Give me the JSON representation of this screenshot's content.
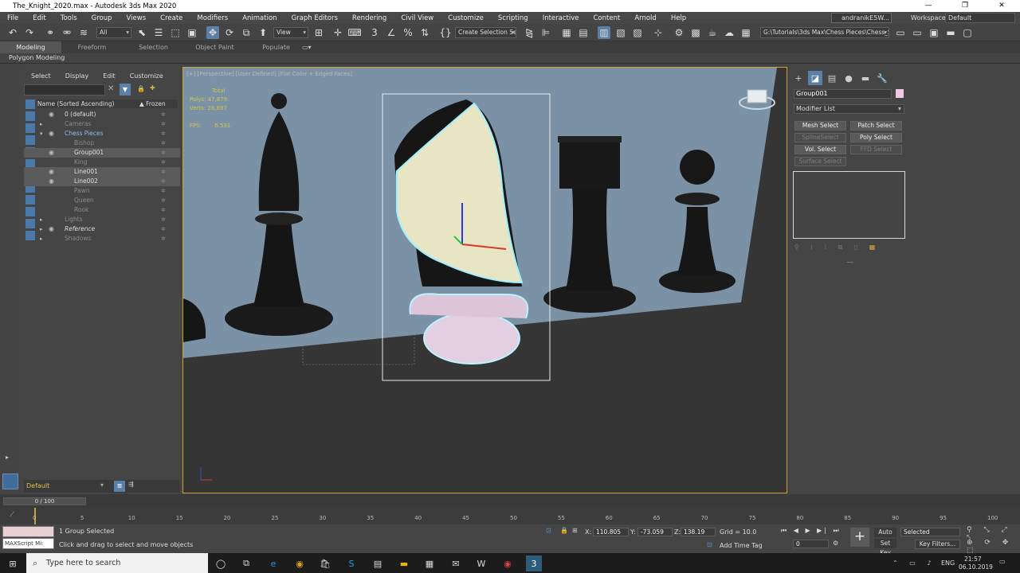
{
  "window": {
    "title": "The_Knight_2020.max - Autodesk 3ds Max 2020",
    "minimize": "—",
    "maximize": "❐",
    "close": "✕"
  },
  "menubar": {
    "items": [
      "File",
      "Edit",
      "Tools",
      "Group",
      "Views",
      "Create",
      "Modifiers",
      "Animation",
      "Graph Editors",
      "Rendering",
      "Civil View",
      "Customize",
      "Scripting",
      "Interactive",
      "Content",
      "Arnold",
      "Help"
    ],
    "user": "andranikE5W...",
    "workspaces_label": "Workspaces:",
    "workspaces_value": "Default"
  },
  "toolbar": {
    "selection_filter": "All",
    "ref_coord": "View",
    "create_selection_set": "Create Selection Se",
    "project_path": "G:\\Tutorials\\3ds Max\\Chess Pieces\\Chess_Set"
  },
  "ribbon": {
    "tabs": [
      "Modeling",
      "Freeform",
      "Selection",
      "Object Paint",
      "Populate"
    ],
    "sub": "Polygon Modeling"
  },
  "scene_explorer": {
    "menu": [
      "Select",
      "Display",
      "Edit",
      "Customize"
    ],
    "col_name": "Name (Sorted Ascending)",
    "col_frozen": "▲ Frozen",
    "rows": [
      {
        "label": "0 (default)",
        "indent": 1
      },
      {
        "label": "Cameras",
        "indent": 1,
        "dim": true
      },
      {
        "label": "Chess Pieces",
        "indent": 1,
        "hl": true
      },
      {
        "label": "Bishop",
        "indent": 2,
        "dim": true
      },
      {
        "label": "Group001",
        "indent": 2,
        "sel": true
      },
      {
        "label": "King",
        "indent": 2,
        "dim": true
      },
      {
        "label": "Line001",
        "indent": 2,
        "sel": true
      },
      {
        "label": "Line002",
        "indent": 2,
        "sel": true
      },
      {
        "label": "Pawn",
        "indent": 2,
        "dim": true
      },
      {
        "label": "Queen",
        "indent": 2,
        "dim": true
      },
      {
        "label": "Rook",
        "indent": 2,
        "dim": true
      },
      {
        "label": "Lights",
        "indent": 1,
        "dim": true
      },
      {
        "label": "Reference",
        "indent": 1,
        "italic": true
      },
      {
        "label": "Shadows",
        "indent": 1,
        "dim": true
      }
    ],
    "layer": "Default"
  },
  "viewport": {
    "label": "[+] [Perspective] [User Defined] [Flat Color + Edged Faces]",
    "stats": {
      "total": "Total",
      "polys_label": "Polys:",
      "polys": "47,879",
      "verts_label": "Verts:",
      "verts": "26,697",
      "fps_label": "FPS:",
      "fps": "6.531"
    }
  },
  "command_panel": {
    "object_name": "Group001",
    "modifier_list": "Modifier List",
    "buttons": [
      {
        "label": "Mesh Select",
        "enabled": true
      },
      {
        "label": "Patch Select",
        "enabled": true
      },
      {
        "label": "SplineSelect",
        "enabled": false
      },
      {
        "label": "Poly Select",
        "enabled": true
      },
      {
        "label": "Vol. Select",
        "enabled": true
      },
      {
        "label": "FFD Select",
        "enabled": false
      },
      {
        "label": "Surface Select",
        "enabled": false
      }
    ]
  },
  "timeline": {
    "frame": "0 / 100",
    "ticks": [
      "0",
      "5",
      "10",
      "15",
      "20",
      "25",
      "30",
      "35",
      "40",
      "45",
      "50",
      "55",
      "60",
      "65",
      "70",
      "75",
      "80",
      "85",
      "90",
      "95",
      "100"
    ]
  },
  "status": {
    "maxscript": "MAXScript Mi:",
    "selected": "1 Group Selected",
    "prompt": "Click and drag to select and move objects",
    "x_label": "X:",
    "x": "110.805",
    "y_label": "Y:",
    "y": "-73.059",
    "z_label": "Z:",
    "z": "138.19",
    "grid": "Grid = 10.0",
    "add_time_tag": "Add Time Tag",
    "auto_key": "Auto Key",
    "set_key": "Set Key",
    "selected_dd": "Selected",
    "key_filters": "Key Filters...",
    "frame_field": "0"
  },
  "taskbar": {
    "search": "Type here to search",
    "lang": "ENG",
    "time": "21:57",
    "date": "06.10.2019"
  }
}
